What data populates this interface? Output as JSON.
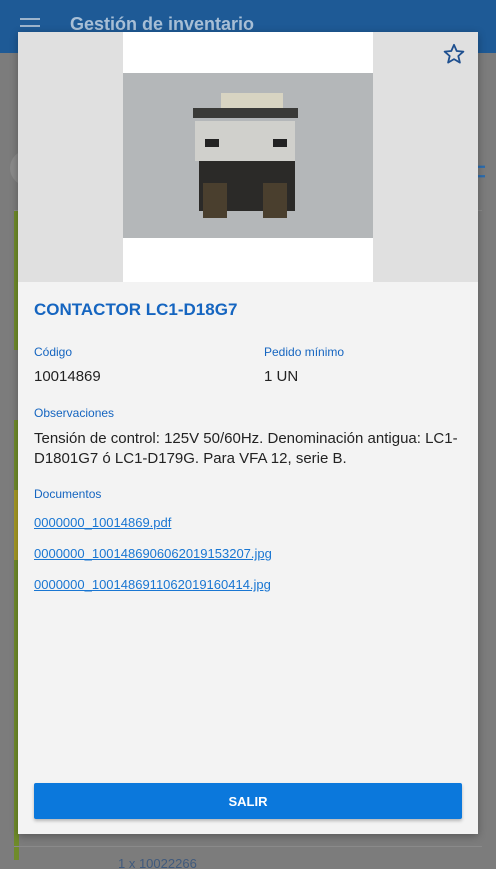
{
  "app_bar": {
    "title": "Gestión de inventario"
  },
  "background": {
    "footer_text": "1 x 10022266"
  },
  "modal": {
    "product_title": "CONTACTOR LC1-D18G7",
    "code_label": "Código",
    "code_value": "10014869",
    "min_order_label": "Pedido mínimo",
    "min_order_value": "1 UN",
    "observations_label": "Observaciones",
    "observations_value": "Tensión de control: 125V 50/60Hz. Denominación antigua: LC1-D1801G7 ó LC1-D179G. Para VFA 12, serie B.",
    "documents_label": "Documentos",
    "documents": [
      "0000000_10014869.pdf",
      "0000000_1001486906062019153207.jpg",
      "0000000_1001486911062019160414.jpg"
    ],
    "exit_label": "SALIR"
  },
  "icons": {
    "favorite": "star-outline-icon",
    "menu": "hamburger-menu-icon"
  },
  "colors": {
    "accent": "#1565c0",
    "button": "#0b78dc",
    "app_bar": "#1e5a96"
  }
}
